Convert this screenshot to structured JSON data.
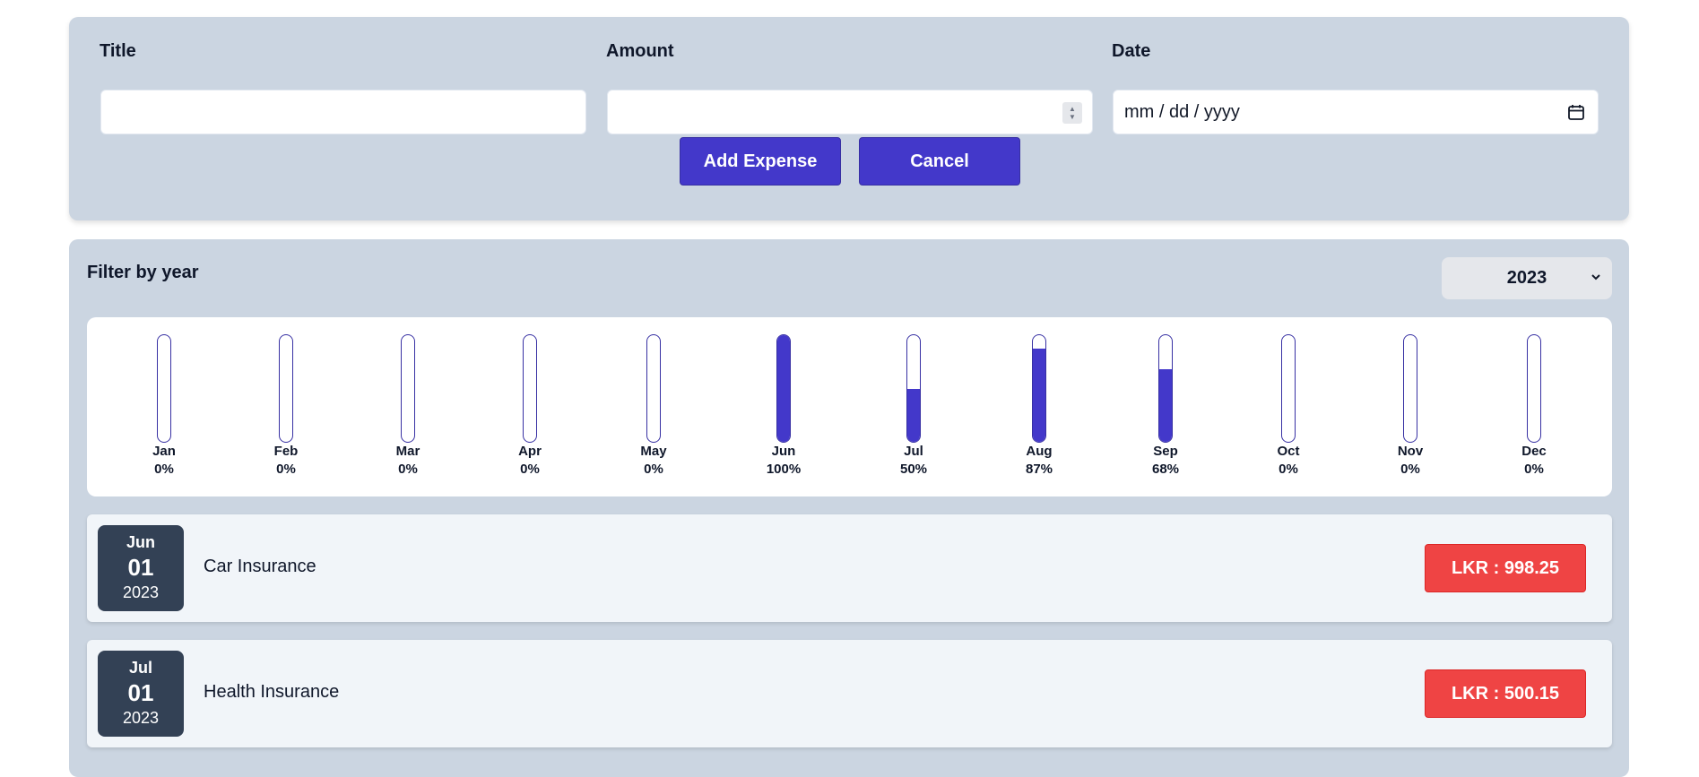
{
  "form": {
    "title_label": "Title",
    "title_value": "",
    "amount_label": "Amount",
    "amount_value": "",
    "date_label": "Date",
    "date_placeholder": "mm / dd / yyyy",
    "add_button": "Add Expense",
    "cancel_button": "Cancel"
  },
  "filter": {
    "label": "Filter by year",
    "selected_year": "2023"
  },
  "chart_data": {
    "type": "bar",
    "categories": [
      "Jan",
      "Feb",
      "Mar",
      "Apr",
      "May",
      "Jun",
      "Jul",
      "Aug",
      "Sep",
      "Oct",
      "Nov",
      "Dec"
    ],
    "values": [
      0,
      0,
      0,
      0,
      0,
      100,
      50,
      87,
      68,
      0,
      0,
      0
    ],
    "labels": [
      "0%",
      "0%",
      "0%",
      "0%",
      "0%",
      "100%",
      "50%",
      "87%",
      "68%",
      "0%",
      "0%",
      "0%"
    ],
    "ylim": [
      0,
      100
    ],
    "grid": false
  },
  "expenses": [
    {
      "month": "Jun",
      "day": "01",
      "year": "2023",
      "title": "Car Insurance",
      "amount": "LKR : 998.25"
    },
    {
      "month": "Jul",
      "day": "01",
      "year": "2023",
      "title": "Health Insurance",
      "amount": "LKR : 500.15"
    }
  ],
  "colors": {
    "panel": "#cbd5e1",
    "accent": "#4338ca",
    "date_box": "#334155",
    "amount_badge": "#ef4444"
  },
  "icons": {
    "date_picker": "calendar-icon",
    "amount_stepper": "stepper-icon",
    "select_arrow": "chevron-down-icon"
  }
}
